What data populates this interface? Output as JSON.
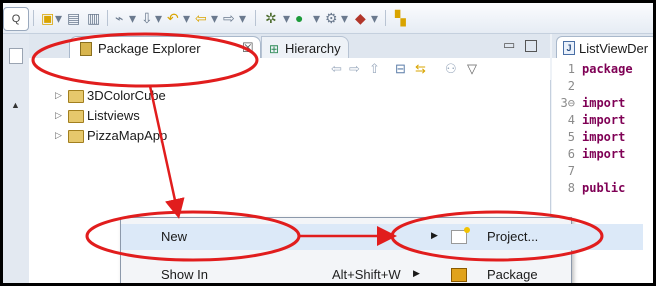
{
  "colors": {
    "annotation": "#e11d1d",
    "highlight": "#dce9f8",
    "keyword": "#7f0055"
  },
  "package_explorer": {
    "tab_label": "Package Explorer",
    "tab_close_glyph": "☒",
    "hierarchy_tab_label": "Hierarchy",
    "projects": [
      {
        "name": "3DColorCube"
      },
      {
        "name": "Listviews"
      },
      {
        "name": "PizzaMapApp"
      }
    ]
  },
  "editor": {
    "tab_label": "ListViewDer",
    "lines": [
      {
        "num": "1",
        "code": "package"
      },
      {
        "num": "2",
        "code": ""
      },
      {
        "num": "3⊖",
        "code": "import"
      },
      {
        "num": "4",
        "code": "import"
      },
      {
        "num": "5",
        "code": "import"
      },
      {
        "num": "6",
        "code": "import"
      },
      {
        "num": "7",
        "code": ""
      },
      {
        "num": "8",
        "code": "public"
      }
    ]
  },
  "context_menu": {
    "items": [
      {
        "label": "New",
        "accel": ""
      },
      {
        "label": "Show In",
        "accel": "Alt+Shift+W"
      }
    ],
    "submenu": [
      {
        "label": "Project...",
        "icon": "new-project-icon"
      },
      {
        "label": "Package",
        "icon": "package-icon"
      }
    ]
  }
}
